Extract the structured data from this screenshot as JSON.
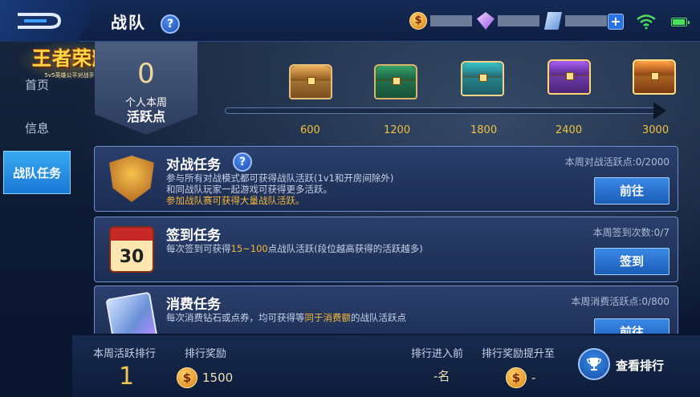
{
  "header": {
    "title": "战队",
    "help_icon": "?",
    "gold_icon_label": "$",
    "add_label": "+"
  },
  "logo": {
    "text": "王者荣耀",
    "sub": "5v5英雄公平对战手游"
  },
  "sidebar": {
    "items": [
      {
        "label": "首页"
      },
      {
        "label": "信息"
      },
      {
        "label": "战队任务"
      }
    ]
  },
  "activity": {
    "points": "0",
    "label_line1": "个人本周",
    "label_line2": "活跃点",
    "milestones": [
      "600",
      "1200",
      "1800",
      "2400",
      "3000"
    ]
  },
  "tasks": [
    {
      "title": "对战任务",
      "help": "?",
      "desc_line1": "参与所有对战模式都可获得战队活跃(1v1和开房间除外)",
      "desc_line2": "和同战队玩家一起游戏可获得更多活跃。",
      "desc_line3": "参加战队赛可获得大量战队活跃。",
      "stat": "本周对战活跃点:0/2000",
      "button": "前往"
    },
    {
      "title": "签到任务",
      "icon_text": "30",
      "desc_prefix": "每次签到可获得",
      "desc_highlight": "15~100",
      "desc_suffix": "点战队活跃(段位越高获得的活跃越多)",
      "stat": "本周签到次数:0/7",
      "button": "签到"
    },
    {
      "title": "消费任务",
      "desc_prefix": "每次消费钻石或点券，均可获得等",
      "desc_highlight": "同于消费额",
      "desc_suffix": "的战队活跃点",
      "stat": "本周消费活跃点:0/800",
      "button": "前往"
    }
  ],
  "footer": {
    "weekly_rank_label": "本周活跃排行",
    "weekly_rank_value": "1",
    "reward_label": "排行奖励",
    "reward_value": "1500",
    "enter_prev_label": "排行进入前",
    "enter_prev_value": "-名",
    "reward_up_label": "排行奖励提升至",
    "reward_up_value": "-",
    "view_rank_button": "查看排行"
  }
}
